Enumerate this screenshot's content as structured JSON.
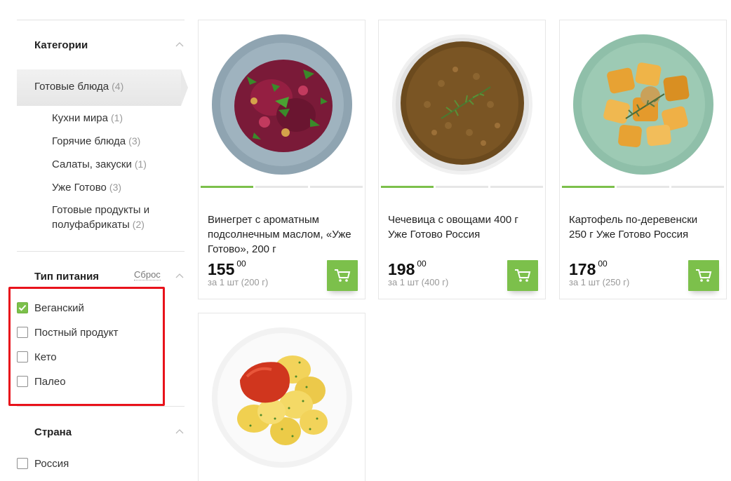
{
  "filters": {
    "categories": {
      "title": "Категории",
      "active": {
        "label": "Готовые блюда",
        "count": "(4)"
      },
      "subcategories": [
        {
          "label": "Кухни мира",
          "count": "(1)"
        },
        {
          "label": "Горячие блюда",
          "count": "(3)"
        },
        {
          "label": "Салаты, закуски",
          "count": "(1)"
        },
        {
          "label": "Уже Готово",
          "count": "(3)"
        },
        {
          "label": "Готовые продукты и полуфабрикаты",
          "count": "(2)"
        }
      ]
    },
    "diet": {
      "title": "Тип питания",
      "reset_label": "Сброс",
      "options": [
        {
          "label": "Веганский",
          "checked": true
        },
        {
          "label": "Постный продукт",
          "checked": false
        },
        {
          "label": "Кето",
          "checked": false
        },
        {
          "label": "Палео",
          "checked": false
        }
      ]
    },
    "country": {
      "title": "Страна",
      "options": [
        {
          "label": "Россия",
          "checked": false
        }
      ]
    }
  },
  "products": [
    {
      "title": "Винегрет с ароматным подсолнечным маслом, «Уже Готово», 200 г",
      "price": "155",
      "kopecks": "00",
      "unit": "за 1 шт (200 г)"
    },
    {
      "title": "Чечевица с овощами 400 г Уже Готово Россия",
      "price": "198",
      "kopecks": "00",
      "unit": "за 1 шт (400 г)"
    },
    {
      "title": "Картофель по-деревенски 250 г Уже Готово Россия",
      "price": "178",
      "kopecks": "00",
      "unit": "за 1 шт (250 г)"
    },
    {
      "title": "",
      "price": "",
      "kopecks": "",
      "unit": ""
    }
  ],
  "colors": {
    "accent_green": "#7cc04b",
    "highlight_red": "#e8121b"
  }
}
